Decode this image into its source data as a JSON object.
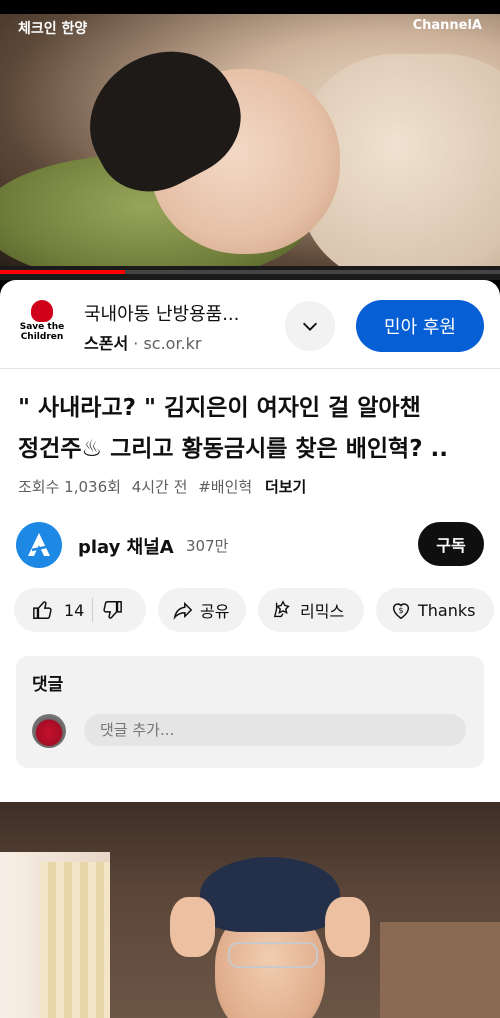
{
  "video": {
    "top_left_label": "체크인 한양",
    "top_right_label": "ChannelA",
    "progress": 0.25
  },
  "ad": {
    "logo_text_line1": "Save the",
    "logo_text_line2": "Children",
    "title": "국내아동 난방용품...",
    "sponsor_label": "스폰서",
    "domain": "sc.or.kr",
    "cta": "민아 후원"
  },
  "video_info": {
    "title_line1": "\" 사내라고? \"  김지은이 여자인 걸 알아챈",
    "title_line2": "정건주♨ 그리고 황동금시를 찾은 배인혁? ..",
    "views": "조회수 1,036회",
    "age": "4시간 전",
    "hashtag": "#배인혁",
    "more": "더보기"
  },
  "channel": {
    "name": "play 채널A",
    "subscribers": "307만",
    "subscribe_label": "구독"
  },
  "actions": {
    "like_count": "14",
    "share_label": "공유",
    "remix_label": "리믹스",
    "thanks_label": "Thanks"
  },
  "comments": {
    "header": "댓글",
    "placeholder": "댓글 추가..."
  },
  "colors": {
    "accent_blue": "#065fd4",
    "progress_red": "#ff0000",
    "pill_bg": "#f2f2f2"
  }
}
